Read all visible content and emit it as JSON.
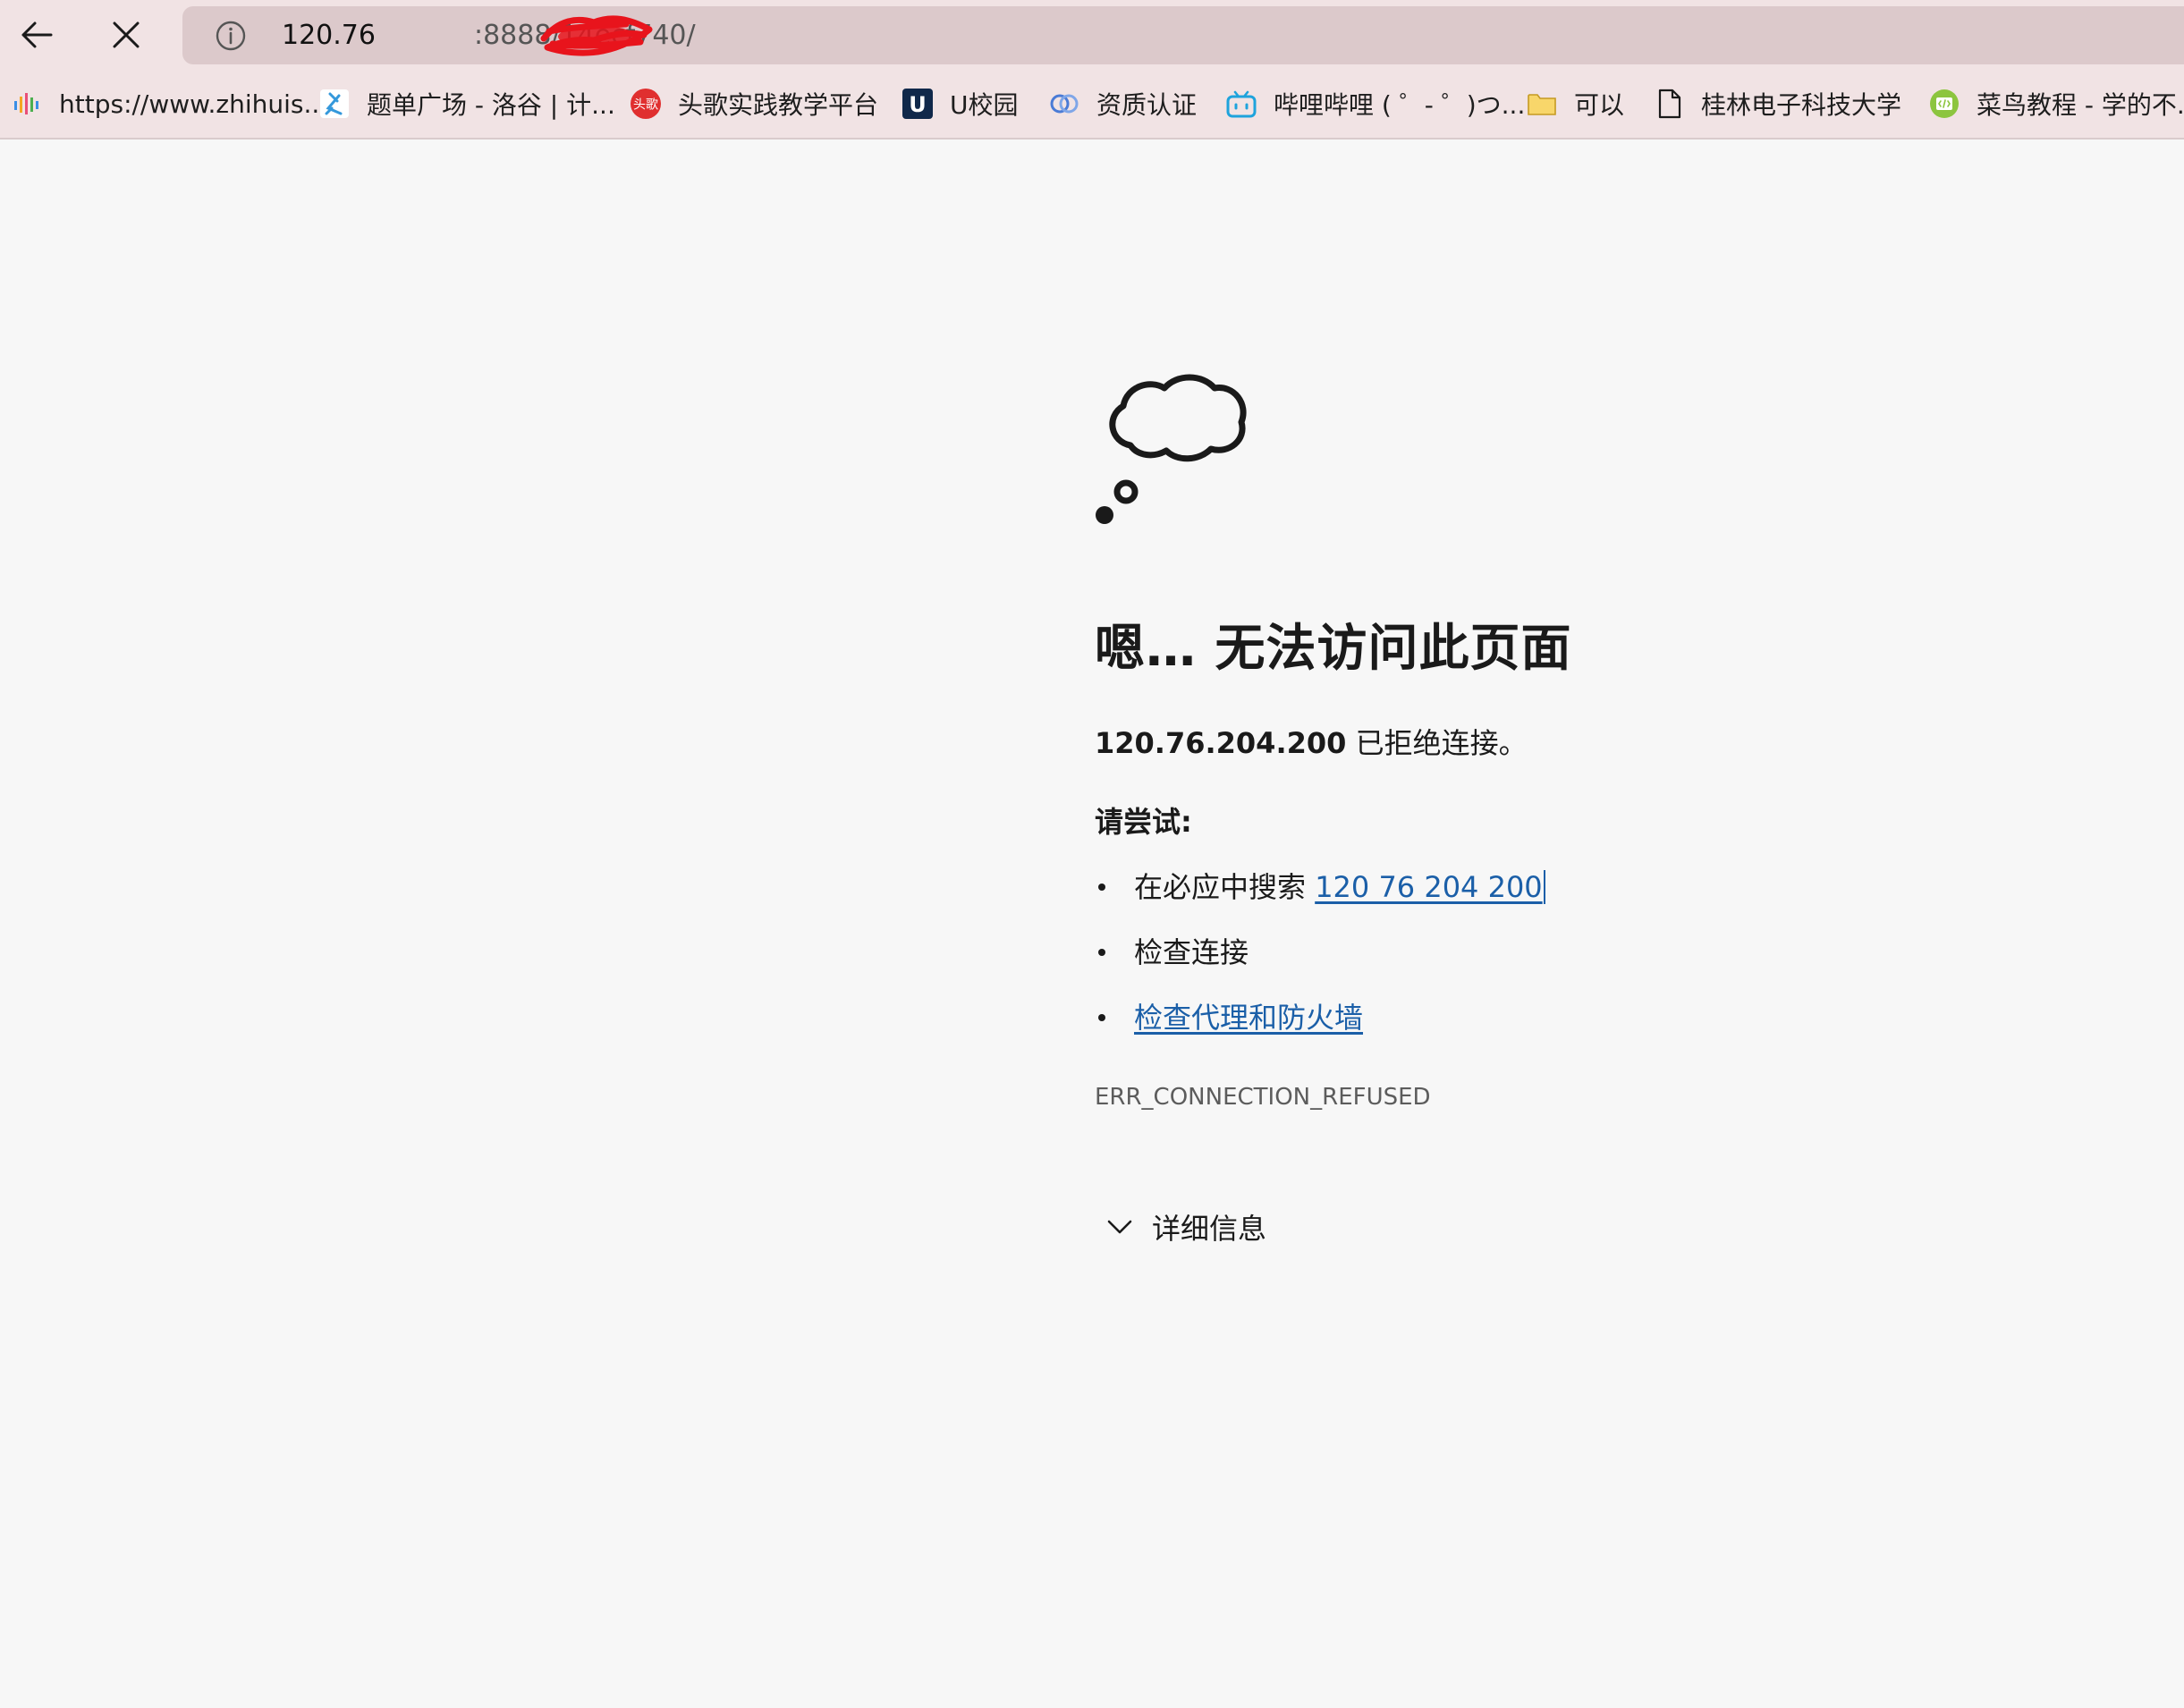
{
  "browser": {
    "address_bar": {
      "url_host": "120.76",
      "url_rest": ":8888/14ecf740/"
    },
    "bookmarks": [
      {
        "label": "https://www.zhihuis...",
        "icon": "zhihuishu-icon"
      },
      {
        "label": "题单广场 - 洛谷 | 计...",
        "icon": "luogu-icon"
      },
      {
        "label": "头歌实践教学平台",
        "icon": "educoder-icon",
        "icon_text": "头歌"
      },
      {
        "label": "U校园",
        "icon": "uschool-icon",
        "icon_text": "U"
      },
      {
        "label": "资质认证",
        "icon": "certification-icon"
      },
      {
        "label": "哔哩哔哩 ( ゜- ゜)つ...",
        "icon": "bilibili-icon"
      },
      {
        "label": "可以",
        "icon": "folder-icon"
      },
      {
        "label": "桂林电子科技大学",
        "icon": "page-icon"
      },
      {
        "label": "菜鸟教程 - 学的不...",
        "icon": "runoob-icon"
      }
    ]
  },
  "error_page": {
    "title": "嗯… 无法访问此页面",
    "message_host": "120.76.204.200",
    "message_text": " 已拒绝连接。",
    "try_title": "请尝试:",
    "suggestions": {
      "search_prefix": "在必应中搜索 ",
      "search_link": "120 76 204 200",
      "check_connection": "检查连接",
      "check_proxy_link": "检查代理和防火墙"
    },
    "error_code": "ERR_CONNECTION_REFUSED",
    "details_label": "详细信息"
  },
  "colors": {
    "chrome_background": "#f1e3e4",
    "address_bar_background": "#dcc9cb",
    "page_background": "#f7f7f7",
    "link": "#1b5fa8",
    "redaction": "#e8141c"
  }
}
